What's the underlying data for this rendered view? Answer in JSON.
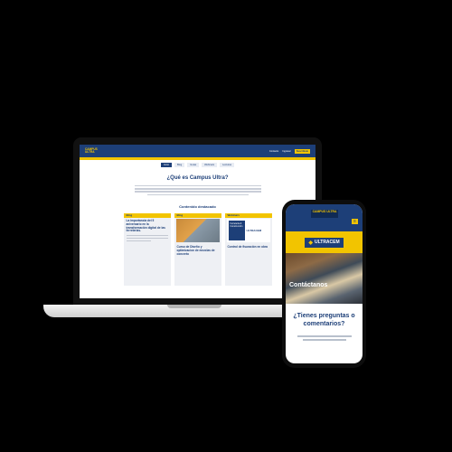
{
  "laptop": {
    "logo": "CAMPUS ULTRA",
    "top_links": [
      "Contacto",
      "Ingresar"
    ],
    "cta": "Suscríbete",
    "nav": [
      "Inicio",
      "Blog",
      "Guías",
      "Webinars",
      "Lecturas"
    ],
    "headline": "¿Qué es Campus Ultra?",
    "featured_title": "Contenido destacado",
    "cards": [
      {
        "label": "Blog",
        "title": "La importancia del 5 aniversario en la transformación digital de las ferreterías."
      },
      {
        "label": "Blog",
        "title": "Curso de Diseño y optimizacion de mezclas de concreto"
      },
      {
        "label": "Webinars",
        "cover": "Ferretería & Construcción",
        "logo": "ULTRACEM",
        "title": "Control de fisuración en obra"
      }
    ]
  },
  "phone": {
    "logo": "CAMPUS ULTRA",
    "menu_icon": "hamburger-icon",
    "brand": "ULTRACEM",
    "hero_title": "Contáctanos",
    "cta_title": "¿Tienes preguntas o comentarios?"
  },
  "colors": {
    "navy": "#1d3f78",
    "yellow": "#f2c400"
  }
}
